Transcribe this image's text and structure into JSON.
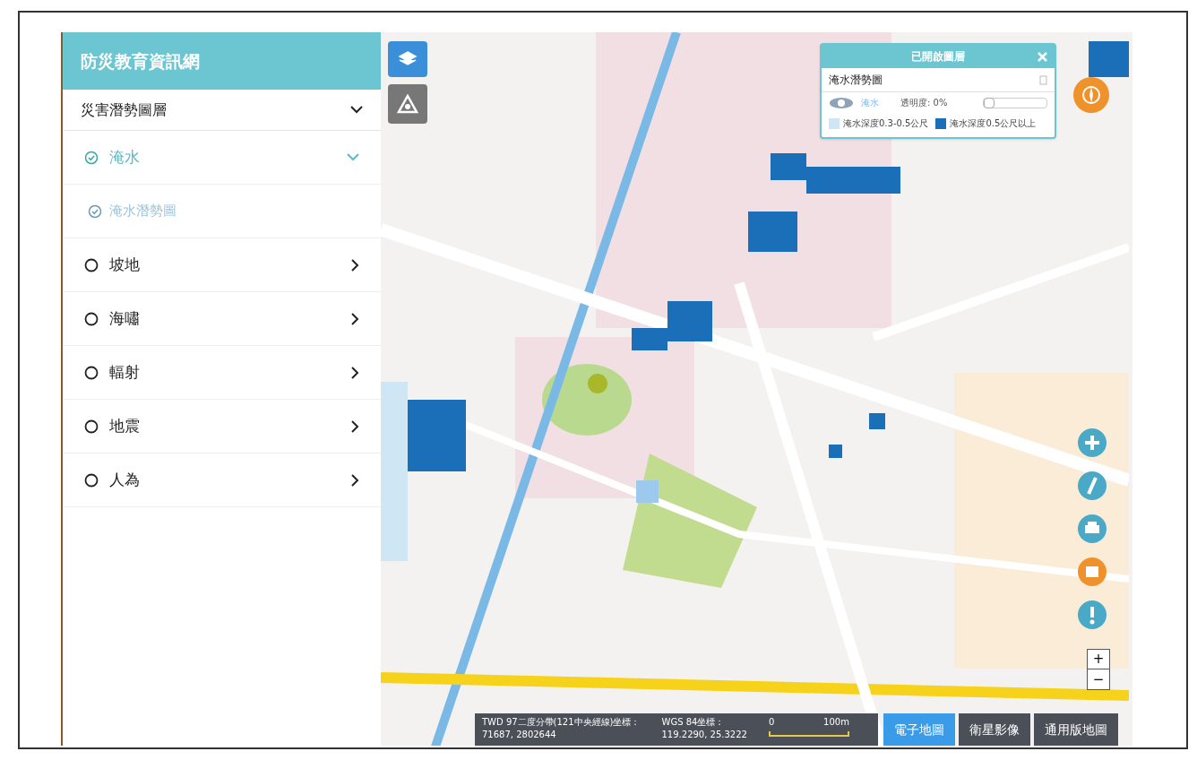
{
  "app_title": "防災教育資訊網",
  "layer_panel": {
    "title": "災害潛勢圖層",
    "expanded": true,
    "categories": [
      {
        "label": "淹水",
        "checked": true,
        "expanded": true,
        "children": [
          {
            "label": "淹水潛勢圖",
            "checked": true
          }
        ]
      },
      {
        "label": "坡地",
        "checked": false,
        "expanded": false
      },
      {
        "label": "海嘯",
        "checked": false,
        "expanded": false
      },
      {
        "label": "輻射",
        "checked": false,
        "expanded": false
      },
      {
        "label": "地震",
        "checked": false,
        "expanded": false
      },
      {
        "label": "人為",
        "checked": false,
        "expanded": false
      }
    ]
  },
  "legend": {
    "title": "已開啟圖層",
    "layer_name": "淹水潛勢圖",
    "visible": true,
    "visibility_label": "淹水",
    "opacity_label": "透明度: 0%",
    "opacity": {
      "level": 0
    },
    "items": [
      {
        "label": "淹水深度0.3-0.5公尺",
        "color": "#cfe6f5"
      },
      {
        "label": "淹水深度0.5公尺以上",
        "color": "#1a6fb8"
      }
    ]
  },
  "zoom": {
    "in": "+",
    "out": "−"
  },
  "status_bar": {
    "twd_label": "TWD 97二度分帶(121中央經線)坐標：",
    "twd_value": "71687, 2802644",
    "wgs_label": "WGS 84坐標：",
    "wgs_value": "119.2290, 25.3222",
    "scale_start": "0",
    "scale_end": "100m"
  },
  "basemaps": [
    {
      "label": "電子地圖",
      "selected": true
    },
    {
      "label": "衛星影像",
      "selected": false
    },
    {
      "label": "通用版地圖",
      "selected": false
    }
  ]
}
